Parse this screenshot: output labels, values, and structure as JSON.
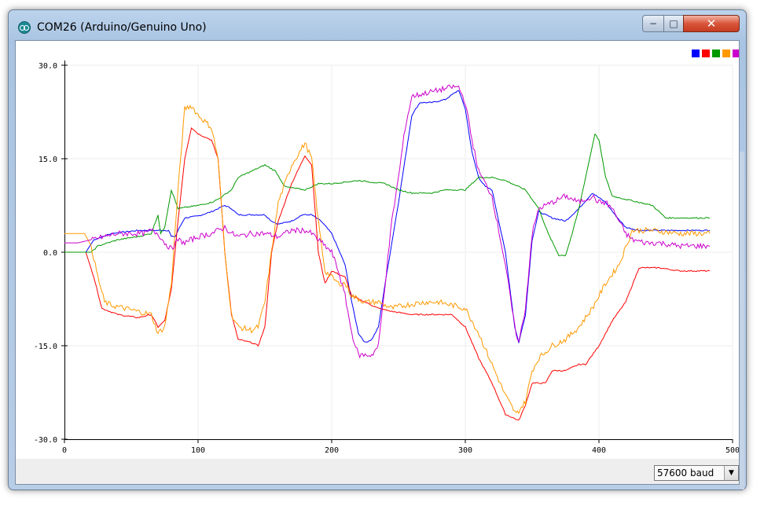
{
  "window": {
    "title": "COM26 (Arduino/Genuino Uno)",
    "minimize_label": "−",
    "maximize_label": "□",
    "close_label": "✕"
  },
  "toolbar": {
    "baud_value": "57600 baud",
    "baud_arrow": "▼"
  },
  "icons": {
    "app": "arduino-icon"
  },
  "chart_data": {
    "type": "line",
    "title": "",
    "xlabel": "",
    "ylabel": "",
    "xlim": [
      0,
      500
    ],
    "ylim": [
      -30,
      30
    ],
    "xticks": [
      0,
      100,
      200,
      300,
      400,
      500
    ],
    "yticks": [
      30,
      15,
      0,
      -15,
      -30
    ],
    "ytick_labels": [
      "30.0",
      "15.0",
      "0.0",
      "-15.0",
      "-30.0"
    ],
    "grid": true,
    "legend": "top-right",
    "series": [
      {
        "color": "#0000ff",
        "points": [
          [
            0,
            0
          ],
          [
            16,
            0
          ],
          [
            22,
            2
          ],
          [
            35,
            3
          ],
          [
            55,
            3.5
          ],
          [
            70,
            3.5
          ],
          [
            78,
            3.5
          ],
          [
            80,
            2.5
          ],
          [
            83,
            2.5
          ],
          [
            85,
            3.5
          ],
          [
            90,
            5.5
          ],
          [
            100,
            5.8
          ],
          [
            110,
            6.5
          ],
          [
            120,
            7.5
          ],
          [
            125,
            7
          ],
          [
            130,
            6
          ],
          [
            150,
            6
          ],
          [
            155,
            5
          ],
          [
            160,
            4.5
          ],
          [
            170,
            5
          ],
          [
            178,
            6
          ],
          [
            185,
            6
          ],
          [
            192,
            5
          ],
          [
            200,
            3
          ],
          [
            210,
            -2
          ],
          [
            215,
            -8
          ],
          [
            220,
            -13
          ],
          [
            225,
            -14.5
          ],
          [
            230,
            -14
          ],
          [
            235,
            -12
          ],
          [
            240,
            -5
          ],
          [
            250,
            8
          ],
          [
            255,
            15
          ],
          [
            260,
            22
          ],
          [
            266,
            24
          ],
          [
            275,
            24
          ],
          [
            285,
            24.5
          ],
          [
            295,
            26
          ],
          [
            300,
            23
          ],
          [
            305,
            16
          ],
          [
            310,
            12
          ],
          [
            315,
            10.5
          ],
          [
            320,
            10
          ],
          [
            330,
            0
          ],
          [
            337,
            -12
          ],
          [
            340,
            -14.5
          ],
          [
            345,
            -10
          ],
          [
            350,
            2
          ],
          [
            355,
            6.5
          ],
          [
            365,
            5.5
          ],
          [
            375,
            5
          ],
          [
            385,
            7
          ],
          [
            395,
            9.5
          ],
          [
            405,
            8
          ],
          [
            412,
            6
          ],
          [
            420,
            4
          ],
          [
            430,
            3.5
          ],
          [
            450,
            3.5
          ],
          [
            483,
            3.5
          ]
        ]
      },
      {
        "color": "#ff0000",
        "points": [
          [
            0,
            0
          ],
          [
            16,
            0
          ],
          [
            22,
            -4
          ],
          [
            28,
            -9
          ],
          [
            40,
            -10
          ],
          [
            55,
            -10.5
          ],
          [
            65,
            -10
          ],
          [
            70,
            -12
          ],
          [
            75,
            -11
          ],
          [
            80,
            -6
          ],
          [
            85,
            5
          ],
          [
            90,
            15
          ],
          [
            95,
            20
          ],
          [
            100,
            19
          ],
          [
            110,
            18
          ],
          [
            115,
            15
          ],
          [
            120,
            0
          ],
          [
            125,
            -10
          ],
          [
            130,
            -14
          ],
          [
            140,
            -14.5
          ],
          [
            145,
            -15
          ],
          [
            150,
            -12
          ],
          [
            155,
            0
          ],
          [
            160,
            5
          ],
          [
            170,
            11
          ],
          [
            180,
            15.5
          ],
          [
            185,
            14
          ],
          [
            190,
            0
          ],
          [
            195,
            -5
          ],
          [
            200,
            -3
          ],
          [
            210,
            -4
          ],
          [
            215,
            -7
          ],
          [
            225,
            -8
          ],
          [
            235,
            -9
          ],
          [
            245,
            -9.5
          ],
          [
            260,
            -10
          ],
          [
            280,
            -10
          ],
          [
            290,
            -10
          ],
          [
            300,
            -12
          ],
          [
            310,
            -17
          ],
          [
            320,
            -21
          ],
          [
            330,
            -26
          ],
          [
            340,
            -27
          ],
          [
            345,
            -24.5
          ],
          [
            350,
            -21
          ],
          [
            360,
            -21
          ],
          [
            365,
            -19
          ],
          [
            375,
            -19
          ],
          [
            385,
            -18
          ],
          [
            390,
            -18
          ],
          [
            400,
            -15
          ],
          [
            410,
            -11
          ],
          [
            420,
            -8
          ],
          [
            430,
            -2.5
          ],
          [
            445,
            -2.5
          ],
          [
            460,
            -3
          ],
          [
            483,
            -3
          ]
        ]
      },
      {
        "color": "#009900",
        "points": [
          [
            0,
            0
          ],
          [
            20,
            0
          ],
          [
            25,
            1
          ],
          [
            40,
            2
          ],
          [
            55,
            2.5
          ],
          [
            65,
            3
          ],
          [
            70,
            6
          ],
          [
            72,
            3
          ],
          [
            75,
            4
          ],
          [
            80,
            10
          ],
          [
            85,
            7
          ],
          [
            100,
            7.5
          ],
          [
            110,
            8
          ],
          [
            115,
            8.5
          ],
          [
            125,
            10
          ],
          [
            130,
            12
          ],
          [
            140,
            13
          ],
          [
            150,
            14
          ],
          [
            158,
            13
          ],
          [
            165,
            10.5
          ],
          [
            180,
            10
          ],
          [
            190,
            11
          ],
          [
            200,
            11
          ],
          [
            220,
            11.5
          ],
          [
            240,
            11
          ],
          [
            250,
            10
          ],
          [
            260,
            9.5
          ],
          [
            275,
            9.5
          ],
          [
            285,
            10
          ],
          [
            300,
            10
          ],
          [
            310,
            12
          ],
          [
            320,
            12
          ],
          [
            330,
            11.5
          ],
          [
            345,
            10
          ],
          [
            355,
            7
          ],
          [
            362,
            3
          ],
          [
            370,
            -0.5
          ],
          [
            375,
            -0.5
          ],
          [
            380,
            3
          ],
          [
            385,
            7
          ],
          [
            392,
            14
          ],
          [
            397,
            19
          ],
          [
            400,
            18
          ],
          [
            405,
            12
          ],
          [
            410,
            9
          ],
          [
            420,
            8.5
          ],
          [
            430,
            8
          ],
          [
            440,
            7.5
          ],
          [
            445,
            6.5
          ],
          [
            450,
            5.5
          ],
          [
            483,
            5.5
          ]
        ]
      },
      {
        "color": "#ff9900",
        "points": [
          [
            0,
            3
          ],
          [
            15,
            3
          ],
          [
            20,
            1
          ],
          [
            25,
            -4
          ],
          [
            30,
            -8
          ],
          [
            35,
            -8.5
          ],
          [
            45,
            -9
          ],
          [
            55,
            -9.5
          ],
          [
            65,
            -10
          ],
          [
            70,
            -13
          ],
          [
            75,
            -12
          ],
          [
            80,
            -5
          ],
          [
            85,
            10
          ],
          [
            90,
            23
          ],
          [
            95,
            23.5
          ],
          [
            100,
            22
          ],
          [
            105,
            21
          ],
          [
            110,
            20
          ],
          [
            115,
            15
          ],
          [
            120,
            0
          ],
          [
            125,
            -10
          ],
          [
            130,
            -12
          ],
          [
            140,
            -12.5
          ],
          [
            145,
            -12
          ],
          [
            150,
            -8
          ],
          [
            155,
            0
          ],
          [
            160,
            8
          ],
          [
            170,
            14
          ],
          [
            180,
            17.5
          ],
          [
            185,
            15
          ],
          [
            190,
            5
          ],
          [
            195,
            -3
          ],
          [
            200,
            -4
          ],
          [
            205,
            -5
          ],
          [
            210,
            -5
          ],
          [
            215,
            -7
          ],
          [
            225,
            -8
          ],
          [
            235,
            -8
          ],
          [
            245,
            -9
          ],
          [
            255,
            -8.5
          ],
          [
            270,
            -8
          ],
          [
            280,
            -8
          ],
          [
            290,
            -8.5
          ],
          [
            300,
            -9
          ],
          [
            310,
            -13
          ],
          [
            320,
            -18
          ],
          [
            330,
            -23
          ],
          [
            338,
            -26
          ],
          [
            345,
            -24
          ],
          [
            350,
            -19
          ],
          [
            355,
            -17
          ],
          [
            365,
            -15
          ],
          [
            375,
            -14
          ],
          [
            385,
            -12
          ],
          [
            395,
            -9
          ],
          [
            405,
            -5
          ],
          [
            415,
            -2
          ],
          [
            425,
            3.5
          ],
          [
            440,
            3.5
          ],
          [
            460,
            3
          ],
          [
            483,
            3
          ]
        ]
      },
      {
        "color": "#cc00cc",
        "points": [
          [
            0,
            1.5
          ],
          [
            10,
            1.5
          ],
          [
            20,
            2
          ],
          [
            30,
            2.5
          ],
          [
            40,
            3
          ],
          [
            50,
            3
          ],
          [
            60,
            3
          ],
          [
            65,
            3.5
          ],
          [
            70,
            3
          ],
          [
            75,
            1.5
          ],
          [
            80,
            0.5
          ],
          [
            85,
            2
          ],
          [
            90,
            1.5
          ],
          [
            100,
            2.5
          ],
          [
            110,
            3
          ],
          [
            115,
            3.5
          ],
          [
            120,
            4
          ],
          [
            125,
            3
          ],
          [
            130,
            2.5
          ],
          [
            140,
            3
          ],
          [
            150,
            3
          ],
          [
            160,
            2.5
          ],
          [
            165,
            3
          ],
          [
            170,
            3.5
          ],
          [
            180,
            3.5
          ],
          [
            185,
            3
          ],
          [
            190,
            2
          ],
          [
            195,
            1
          ],
          [
            200,
            0
          ],
          [
            205,
            -3
          ],
          [
            210,
            -7
          ],
          [
            215,
            -13
          ],
          [
            220,
            -16.5
          ],
          [
            230,
            -16.5
          ],
          [
            235,
            -15
          ],
          [
            240,
            -5
          ],
          [
            245,
            5
          ],
          [
            250,
            12
          ],
          [
            255,
            20
          ],
          [
            260,
            25
          ],
          [
            270,
            25.5
          ],
          [
            280,
            26
          ],
          [
            290,
            26.5
          ],
          [
            295,
            26.5
          ],
          [
            300,
            24
          ],
          [
            305,
            18
          ],
          [
            310,
            13
          ],
          [
            315,
            11
          ],
          [
            320,
            9
          ],
          [
            330,
            -2
          ],
          [
            337,
            -12
          ],
          [
            340,
            -14.5
          ],
          [
            345,
            -9
          ],
          [
            350,
            3
          ],
          [
            355,
            7
          ],
          [
            365,
            8
          ],
          [
            375,
            9
          ],
          [
            385,
            8
          ],
          [
            395,
            9
          ],
          [
            400,
            8
          ],
          [
            405,
            8
          ],
          [
            410,
            7
          ],
          [
            415,
            5
          ],
          [
            420,
            3
          ],
          [
            425,
            2
          ],
          [
            435,
            1.5
          ],
          [
            445,
            1.5
          ],
          [
            460,
            1
          ],
          [
            483,
            1
          ]
        ]
      }
    ]
  }
}
